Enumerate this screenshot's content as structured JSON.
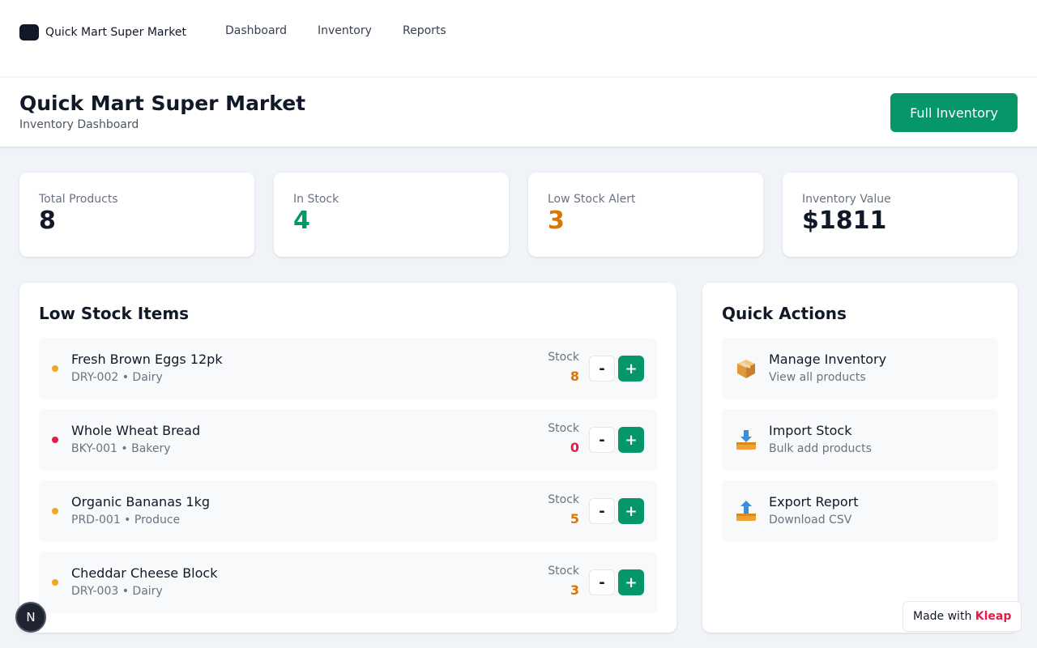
{
  "nav": {
    "brand": "Quick Mart Super Market",
    "links": [
      "Dashboard",
      "Inventory",
      "Reports"
    ]
  },
  "header": {
    "title": "Quick Mart Super Market",
    "subtitle": "Inventory Dashboard",
    "button": "Full Inventory"
  },
  "stats": [
    {
      "label": "Total Products",
      "value": "8",
      "color": "#111827"
    },
    {
      "label": "In Stock",
      "value": "4",
      "color": "#059669"
    },
    {
      "label": "Low Stock Alert",
      "value": "3",
      "color": "#d97706"
    },
    {
      "label": "Inventory Value",
      "value": "$1811",
      "color": "#111827"
    }
  ],
  "low_stock": {
    "title": "Low Stock Items",
    "stock_label": "Stock",
    "minus_label": "-",
    "plus_label": "+",
    "items": [
      {
        "name": "Fresh Brown Eggs 12pk",
        "meta": "DRY-002 • Dairy",
        "stock": "8",
        "status_color": "#f5a623",
        "stock_color": "#d97706"
      },
      {
        "name": "Whole Wheat Bread",
        "meta": "BKY-001 • Bakery",
        "stock": "0",
        "status_color": "#e11d48",
        "stock_color": "#e11d48"
      },
      {
        "name": "Organic Bananas 1kg",
        "meta": "PRD-001 • Produce",
        "stock": "5",
        "status_color": "#f5a623",
        "stock_color": "#d97706"
      },
      {
        "name": "Cheddar Cheese Block",
        "meta": "DRY-003 • Dairy",
        "stock": "3",
        "status_color": "#f5a623",
        "stock_color": "#d97706"
      }
    ]
  },
  "quick_actions": {
    "title": "Quick Actions",
    "items": [
      {
        "icon": "package-icon",
        "title": "Manage Inventory",
        "subtitle": "View all products"
      },
      {
        "icon": "inbox-tray-icon",
        "title": "Import Stock",
        "subtitle": "Bulk add products"
      },
      {
        "icon": "outbox-tray-icon",
        "title": "Export Report",
        "subtitle": "Download CSV"
      }
    ]
  },
  "floating": {
    "badge": "N",
    "made_with": "Made with",
    "made_with_brand": "Kleap"
  }
}
